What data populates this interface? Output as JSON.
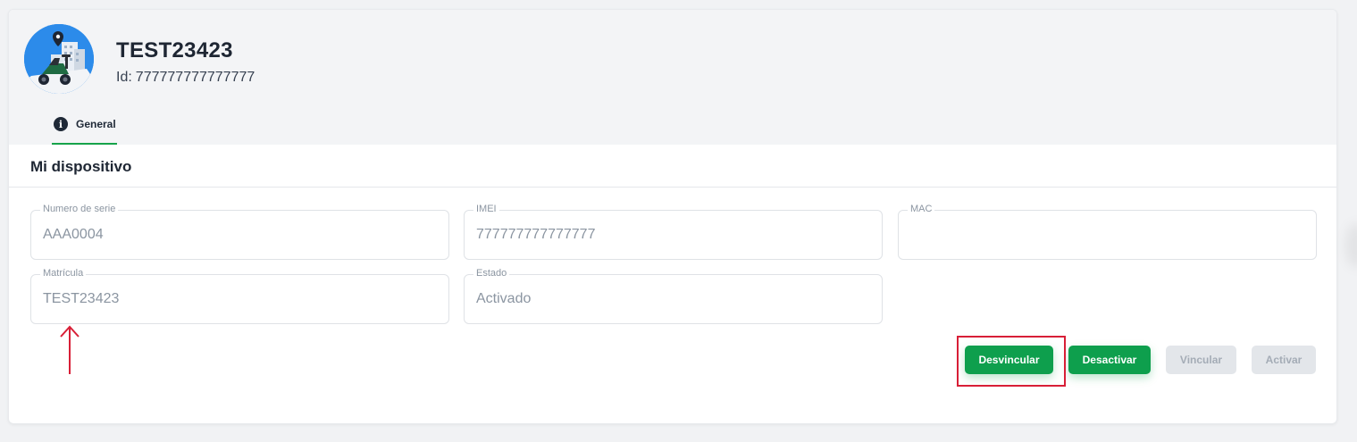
{
  "device": {
    "name": "TEST23423",
    "id_label": "Id:",
    "id_value": "777777777777777"
  },
  "tabs": [
    {
      "label": "General",
      "icon": "info-icon",
      "active": true
    }
  ],
  "section": {
    "title": "Mi dispositivo"
  },
  "fields": {
    "serial": {
      "label": "Numero de serie",
      "value": "AAA0004"
    },
    "imei": {
      "label": "IMEI",
      "value": "777777777777777"
    },
    "mac": {
      "label": "MAC",
      "value": ""
    },
    "plate": {
      "label": "Matrícula",
      "value": "TEST23423"
    },
    "status": {
      "label": "Estado",
      "value": "Activado"
    }
  },
  "actions": {
    "unlink": "Desvincular",
    "deactivate": "Desactivar",
    "link": "Vincular",
    "activate": "Activar"
  },
  "colors": {
    "accent_green": "#0e9f4d",
    "annotation_red": "#d81f37",
    "header_bg": "#f3f4f6",
    "disabled_button": "#e3e6ea"
  }
}
